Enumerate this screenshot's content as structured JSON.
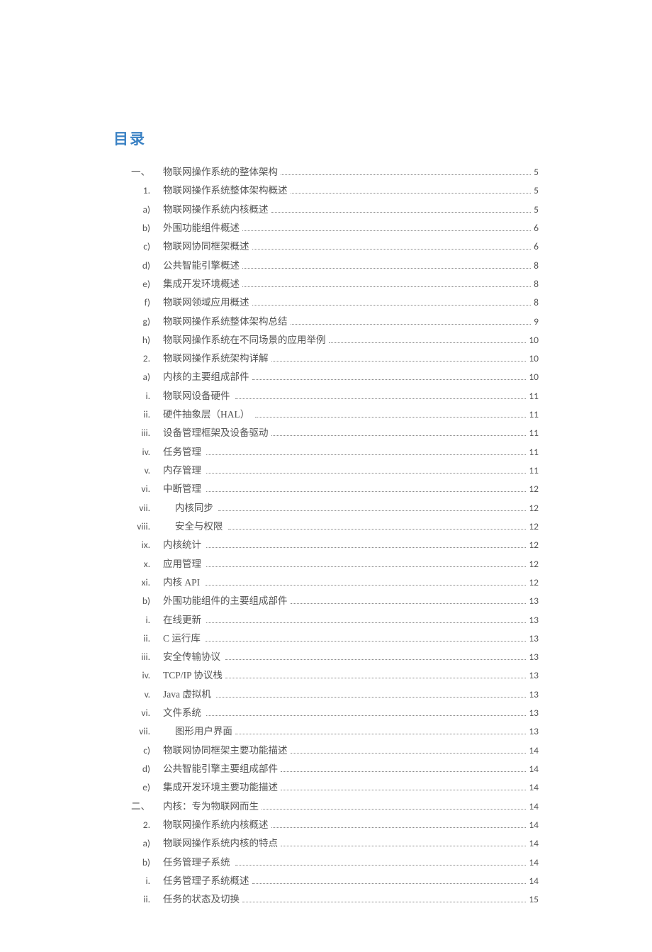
{
  "heading": "目录",
  "entries": [
    {
      "marker": "一、",
      "markerCjk": true,
      "title": "物联网操作系统的整体架构",
      "page": "5"
    },
    {
      "marker": "1.",
      "title": "物联网操作系统整体架构概述",
      "page": "5"
    },
    {
      "marker": "a)",
      "title": "物联网操作系统内核概述",
      "page": "5"
    },
    {
      "marker": "b)",
      "title": "外围功能组件概述",
      "page": "6"
    },
    {
      "marker": "c)",
      "title": "物联网协同框架概述",
      "page": "6"
    },
    {
      "marker": "d)",
      "title": "公共智能引擎概述",
      "page": "8"
    },
    {
      "marker": "e)",
      "title": "集成开发环境概述",
      "page": "8"
    },
    {
      "marker": "f)",
      "title": "物联网领域应用概述",
      "page": "8"
    },
    {
      "marker": "g)",
      "title": "物联网操作系统整体架构总结",
      "page": "9"
    },
    {
      "marker": "h)",
      "title": "物联网操作系统在不同场景的应用举例",
      "page": "10"
    },
    {
      "marker": "2.",
      "title": "物联网操作系统架构详解",
      "page": "10"
    },
    {
      "marker": "a)",
      "title": "内核的主要组成部件",
      "page": "10"
    },
    {
      "marker": "i.",
      "title": "物联网设备硬件 ",
      "page": "11"
    },
    {
      "marker": "ii.",
      "title": "硬件抽象层（HAL） ",
      "page": "11"
    },
    {
      "marker": "iii.",
      "title": "设备管理框架及设备驱动",
      "page": "11"
    },
    {
      "marker": "iv.",
      "title": "任务管理 ",
      "page": "11"
    },
    {
      "marker": "v.",
      "title": "内存管理 ",
      "page": "11"
    },
    {
      "marker": "vi.",
      "title": "中断管理 ",
      "page": "12"
    },
    {
      "marker": "vii.",
      "title": "     内核同步 ",
      "page": "12"
    },
    {
      "marker": "viii.",
      "title": "     安全与权限 ",
      "page": "12"
    },
    {
      "marker": "ix.",
      "title": "内核统计 ",
      "page": "12"
    },
    {
      "marker": "x.",
      "title": "应用管理 ",
      "page": "12"
    },
    {
      "marker": "xi.",
      "title": "内核 API ",
      "page": "12"
    },
    {
      "marker": "b)",
      "title": "外围功能组件的主要组成部件",
      "page": "13"
    },
    {
      "marker": "i.",
      "title": "在线更新 ",
      "page": "13"
    },
    {
      "marker": "ii.",
      "title": "C 运行库 ",
      "page": "13"
    },
    {
      "marker": "iii.",
      "title": "安全传输协议 ",
      "page": "13"
    },
    {
      "marker": "iv.",
      "title": "TCP/IP 协议栈",
      "page": "13"
    },
    {
      "marker": "v.",
      "title": "Java 虚拟机 ",
      "page": "13"
    },
    {
      "marker": "vi.",
      "title": "文件系统 ",
      "page": "13"
    },
    {
      "marker": "vii.",
      "title": "     图形用户界面",
      "page": "13"
    },
    {
      "marker": "c)",
      "title": "物联网协同框架主要功能描述",
      "page": "14"
    },
    {
      "marker": "d)",
      "title": "公共智能引擎主要组成部件",
      "page": "14"
    },
    {
      "marker": "e)",
      "title": "集成开发环境主要功能描述",
      "page": "14"
    },
    {
      "marker": "二、",
      "markerCjk": true,
      "title": "内核：专为物联网而生",
      "page": "14"
    },
    {
      "marker": "2.",
      "title": "物联网操作系统内核概述",
      "page": "14"
    },
    {
      "marker": "a)",
      "title": "物联网操作系统内核的特点",
      "page": "14"
    },
    {
      "marker": "b)",
      "title": "任务管理子系统 ",
      "page": "14"
    },
    {
      "marker": "i.",
      "title": "任务管理子系统概述",
      "page": "14"
    },
    {
      "marker": "ii.",
      "title": "任务的状态及切换",
      "page": "15"
    }
  ]
}
